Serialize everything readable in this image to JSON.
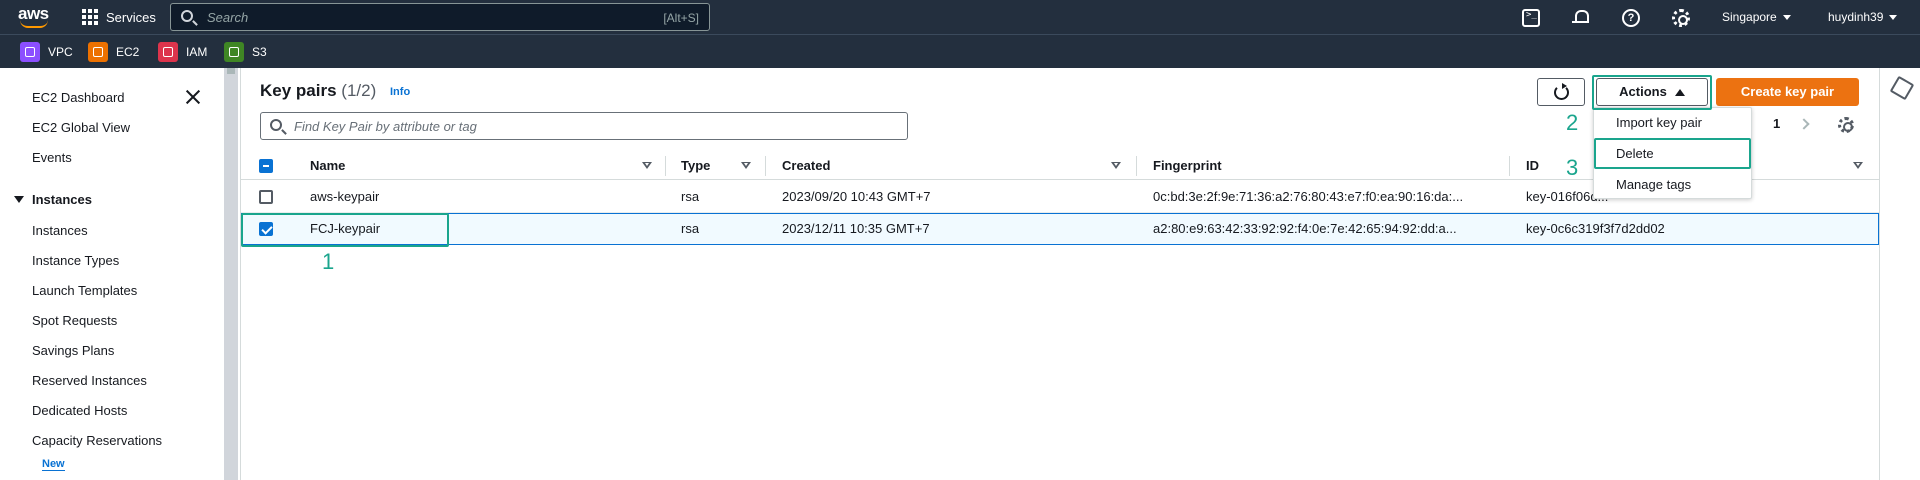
{
  "topnav": {
    "logo_text": "aws",
    "services_label": "Services",
    "search_placeholder": "Search",
    "search_shortcut": "[Alt+S]",
    "region": "Singapore",
    "user": "huydinh39"
  },
  "favorites": [
    {
      "label": "VPC",
      "color": "#8c4fff"
    },
    {
      "label": "EC2",
      "color": "#ed7100"
    },
    {
      "label": "IAM",
      "color": "#dd344c"
    },
    {
      "label": "S3",
      "color": "#3f8624"
    }
  ],
  "sidebar": {
    "items_top": [
      "EC2 Dashboard",
      "EC2 Global View",
      "Events"
    ],
    "section": "Instances",
    "items_section": [
      "Instances",
      "Instance Types",
      "Launch Templates",
      "Spot Requests",
      "Savings Plans",
      "Reserved Instances",
      "Dedicated Hosts",
      "Capacity Reservations"
    ],
    "new_badge": "New"
  },
  "main": {
    "title": "Key pairs",
    "count": "(1/2)",
    "info": "Info",
    "filter_placeholder": "Find Key Pair by attribute or tag",
    "actions_label": "Actions",
    "create_label": "Create key pair",
    "page_number": "1",
    "dropdown": [
      "Import key pair",
      "Delete",
      "Manage tags"
    ],
    "columns": [
      "Name",
      "Type",
      "Created",
      "Fingerprint",
      "ID"
    ],
    "rows": [
      {
        "name": "aws-keypair",
        "type": "rsa",
        "created": "2023/09/20 10:43 GMT+7",
        "fingerprint": "0c:bd:3e:2f:9e:71:36:a2:76:80:43:e7:f0:ea:90:16:da:...",
        "id": "key-016f06d...",
        "selected": false
      },
      {
        "name": "FCJ-keypair",
        "type": "rsa",
        "created": "2023/12/11 10:35 GMT+7",
        "fingerprint": "a2:80:e9:63:42:33:92:92:f4:0e:7e:42:65:94:92:dd:a...",
        "id": "key-0c6c319f3f7d2dd02",
        "selected": true
      }
    ]
  },
  "annotations": [
    "1",
    "2",
    "3"
  ],
  "colors": {
    "accent": "#1aa58d",
    "primary": "#ec7211",
    "link": "#0972d3",
    "nav_bg": "#232f3e"
  }
}
